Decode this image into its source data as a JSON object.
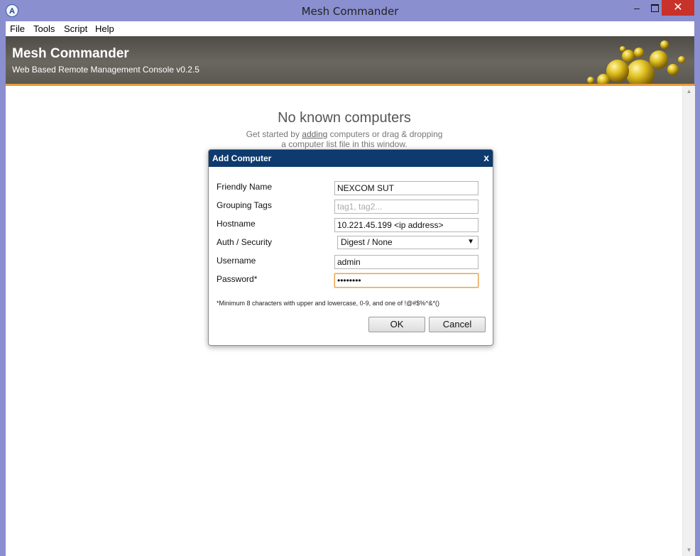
{
  "window": {
    "title": "Mesh Commander",
    "app_icon": "A",
    "minimize": "–",
    "close": "✕"
  },
  "menu": {
    "items": [
      {
        "label": "File"
      },
      {
        "label": "Tools"
      },
      {
        "label": "Script"
      },
      {
        "label": "Help"
      }
    ]
  },
  "banner": {
    "title": "Mesh Commander",
    "subtitle": "Web Based Remote Management Console v0.2.5",
    "accent_color": "#e79c3b"
  },
  "empty_state": {
    "title": "No known computers",
    "line1_before": "Get started by ",
    "line1_link": "adding",
    "line1_after": " computers or drag & dropping",
    "line2": "a computer list file in this window."
  },
  "dialog": {
    "title": "Add Computer",
    "close": "x",
    "fields": {
      "friendly_name": {
        "label": "Friendly Name",
        "value": "NEXCOM SUT"
      },
      "grouping_tags": {
        "label": "Grouping Tags",
        "value": "",
        "placeholder": "tag1, tag2..."
      },
      "hostname": {
        "label": "Hostname",
        "value": "10.221.45.199 <ip address>"
      },
      "auth_security": {
        "label": "Auth / Security",
        "value": "Digest / None"
      },
      "username": {
        "label": "Username",
        "value": "admin"
      },
      "password": {
        "label": "Password*",
        "value": "••••••••"
      }
    },
    "note": "*Minimum 8 characters with upper and lowercase, 0-9, and one of !@#$%^&*()",
    "ok_label": "OK",
    "cancel_label": "Cancel",
    "header_color": "#0e3a6d"
  }
}
